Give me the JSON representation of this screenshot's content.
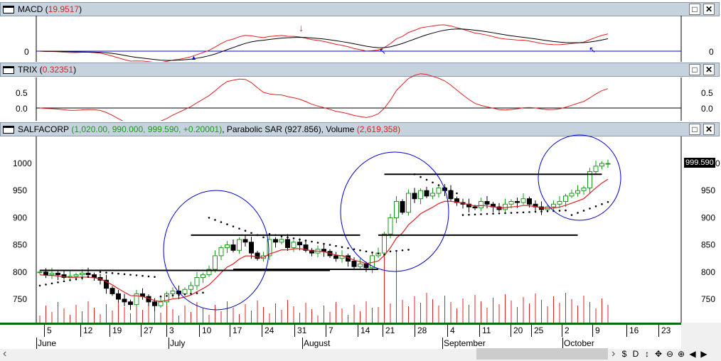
{
  "panes": {
    "macd": {
      "name": "MACD",
      "value": "19.9517",
      "zero_label": "0"
    },
    "trix": {
      "name": "TRIX",
      "value": "0.32351",
      "labels": [
        "0.5",
        "0.0"
      ]
    },
    "price": {
      "symbol": "SALFACORP",
      "ohlc": "1,020.00, 990.000, 999.590, +0.20001",
      "sar_label": "Parabolic SAR",
      "sar_value": "927.856",
      "vol_label": "Volume",
      "vol_value": "2,619,358",
      "y_labels": [
        "1000",
        "950",
        "900",
        "850",
        "800",
        "750"
      ],
      "last_price": "999.590"
    }
  },
  "window_buttons": {
    "maximize": "□",
    "close": "✕"
  },
  "x_axis": {
    "days": [
      "5",
      "12",
      "19",
      "27",
      "3",
      "10",
      "17",
      "24",
      "31",
      "7",
      "14",
      "21",
      "28",
      "4",
      "11",
      "20",
      "25",
      "2",
      "9",
      "16",
      "23"
    ],
    "months": [
      "June",
      "July",
      "August",
      "September",
      "October"
    ]
  },
  "toolbar": {
    "left": "‹",
    "right": "›",
    "items": [
      "$",
      "D",
      "↕",
      "✥",
      "⊖",
      "⊕",
      "◀",
      "▶"
    ]
  },
  "colors": {
    "up": "#1a9a1a",
    "down": "#000000",
    "ma": "#e02020",
    "volume": "#e02020",
    "zero": "#0000ff",
    "circle": "#0000cc"
  },
  "chart_data": {
    "type": "candlestick",
    "closes": [
      800,
      795,
      798,
      795,
      790,
      792,
      795,
      798,
      795,
      790,
      785,
      770,
      760,
      750,
      745,
      740,
      760,
      755,
      745,
      738,
      745,
      760,
      765,
      760,
      768,
      775,
      790,
      795,
      805,
      830,
      845,
      850,
      840,
      860,
      855,
      835,
      825,
      830,
      860,
      855,
      860,
      845,
      855,
      850,
      840,
      835,
      842,
      838,
      830,
      825,
      830,
      820,
      810,
      815,
      808,
      830,
      835,
      870,
      900,
      930,
      910,
      945,
      935,
      950,
      940,
      945,
      955,
      950,
      935,
      928,
      925,
      920,
      918,
      930,
      925,
      920,
      915,
      925,
      930,
      928,
      935,
      925,
      920,
      915,
      920,
      925,
      930,
      940,
      945,
      950,
      955,
      985,
      995,
      1000,
      1000
    ],
    "resistance_lines": [
      {
        "from": 0,
        "to": 48,
        "level": 803
      },
      {
        "from": 25,
        "to": 53,
        "level": 868
      },
      {
        "from": 32,
        "to": 56,
        "level": 805
      },
      {
        "from": 56,
        "to": 89,
        "level": 868
      },
      {
        "from": 57,
        "to": 93,
        "level": 980
      }
    ],
    "ylim": [
      720,
      1050
    ]
  }
}
